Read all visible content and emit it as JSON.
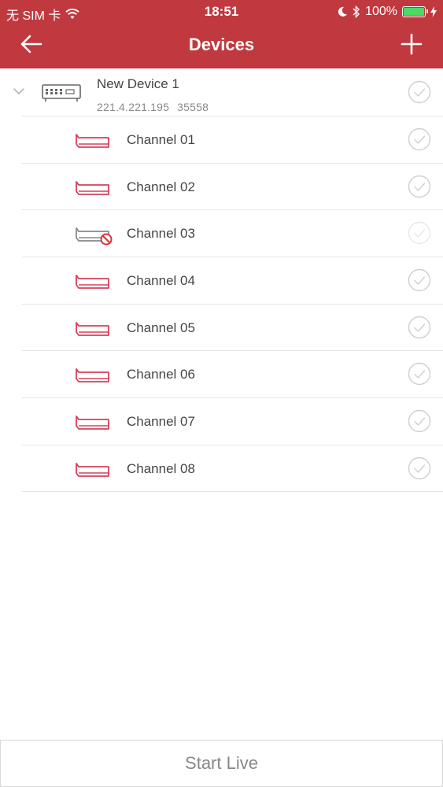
{
  "status_bar": {
    "carrier": "无 SIM 卡",
    "time": "18:51",
    "battery_percent": "100%",
    "battery_level": 1.0,
    "icons": [
      "wifi-icon",
      "moon-icon",
      "bluetooth-icon",
      "battery-icon",
      "charging-icon"
    ]
  },
  "nav": {
    "title": "Devices",
    "back_icon": "arrow-left-icon",
    "add_icon": "plus-icon"
  },
  "device": {
    "name": "New Device 1",
    "ip": "221.4.221.195",
    "port": "35558",
    "expanded": true
  },
  "channels": [
    {
      "label": "Channel 01",
      "offline": false
    },
    {
      "label": "Channel 02",
      "offline": false
    },
    {
      "label": "Channel 03",
      "offline": true
    },
    {
      "label": "Channel 04",
      "offline": false
    },
    {
      "label": "Channel 05",
      "offline": false
    },
    {
      "label": "Channel 06",
      "offline": false
    },
    {
      "label": "Channel 07",
      "offline": false
    },
    {
      "label": "Channel 08",
      "offline": false
    }
  ],
  "bottom": {
    "start_live_label": "Start Live"
  },
  "colors": {
    "accent": "#c0393e",
    "camera_online": "#d6405a",
    "camera_offline": "#888888",
    "offline_badge": "#e0303a"
  }
}
